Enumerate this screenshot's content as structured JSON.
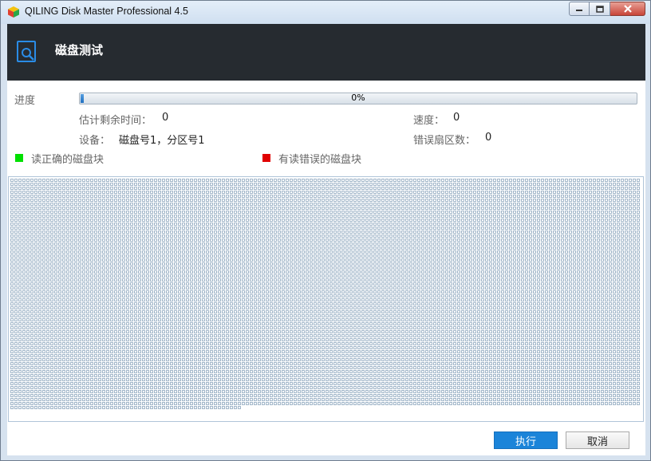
{
  "window": {
    "title": "QILING Disk Master Professional 4.5"
  },
  "header": {
    "title": "磁盘测试",
    "icon": "disk-search-icon"
  },
  "progress": {
    "label": "进度",
    "percent": 0,
    "text": "0%"
  },
  "stats": {
    "remaining_label": "估计剩余时间：",
    "remaining_value": "0",
    "speed_label": "速度：",
    "speed_value": "0",
    "device_label": "设备：",
    "device_value": "磁盘号1，分区号1",
    "bad_label": "错误扇区数：",
    "bad_value": "0"
  },
  "legend": {
    "good_label": "读正确的磁盘块",
    "good_color": "#00e000",
    "bad_label": "有读错误的磁盘块",
    "bad_color": "#e00000"
  },
  "block_map": {
    "color": "#8aa4bc"
  },
  "buttons": {
    "run": "执行",
    "cancel": "取消"
  }
}
